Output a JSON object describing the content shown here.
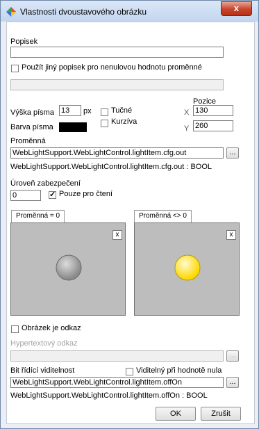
{
  "window": {
    "title": "Vlastnosti dvoustavového obrázku",
    "close_label": "x"
  },
  "caption": {
    "label": "Popisek",
    "value": ""
  },
  "alt_caption": {
    "label": "Použít jiný popisek pro nenulovou hodnotu proměnné",
    "checked": false,
    "value": ""
  },
  "font": {
    "height_label": "Výška písma",
    "height_value": "13",
    "unit": "px",
    "color_label": "Barva písma",
    "color": "#000000",
    "bold_label": "Tučné",
    "italic_label": "Kurzíva"
  },
  "position": {
    "label": "Pozice",
    "x_label": "X",
    "x_value": "130",
    "y_label": "Y",
    "y_value": "260"
  },
  "variable": {
    "label": "Proměnná",
    "value": "WebLightSupport.WebLightControl.lightItem.cfg.out",
    "info": "WebLightSupport.WebLightControl.lightItem.cfg.out : BOOL",
    "browse_label": "..."
  },
  "security": {
    "label": "Úroveň zabezpečení",
    "value": "0",
    "readonly_label": "Pouze pro čtení",
    "readonly_checked": true
  },
  "images": {
    "off_tab": "Proměnná = 0",
    "on_tab": "Proměnná <> 0",
    "clear_label": "x",
    "off_color": "#8a8a8a",
    "on_color": "#ffd800",
    "panel_color": "#bdbdbd"
  },
  "link": {
    "image_is_link_label": "Obrázek je odkaz",
    "hypertext_label": "Hypertextový odkaz",
    "hypertext_value": "",
    "browse_label": "..."
  },
  "visibility": {
    "label": "Bit řídící viditelnost",
    "visible_zero_label": "Viditelný při hodnotě nula",
    "value": "WebLightSupport.WebLightControl.lightItem.offOn",
    "info": "WebLightSupport.WebLightControl.lightItem.offOn : BOOL",
    "browse_label": "..."
  },
  "buttons": {
    "ok": "OK",
    "cancel": "Zrušit"
  },
  "accent": "#c7442a"
}
